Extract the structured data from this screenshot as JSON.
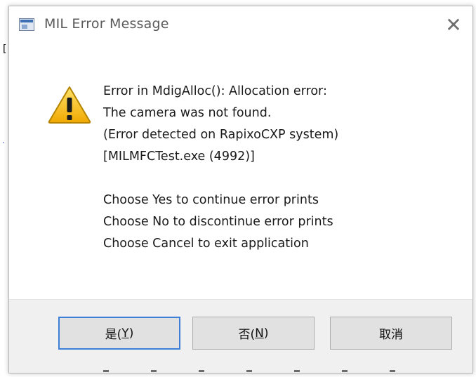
{
  "window": {
    "title": "MIL Error Message",
    "close_glyph": "✕"
  },
  "icons": {
    "app": "app-window-icon",
    "warning": "warning-icon",
    "close": "close-icon"
  },
  "background": {
    "glyph_a": "[",
    "glyph_b": "."
  },
  "message": {
    "lines": [
      "Error in MdigAlloc(): Allocation error:",
      "The camera was not found.",
      "(Error detected on RapixoCXP system)",
      "[MILMFCTest.exe (4992)]",
      "",
      "Choose Yes to continue error prints",
      "Choose No to discontinue error prints",
      "Choose Cancel to exit application"
    ]
  },
  "buttons": {
    "yes": {
      "text": "是(",
      "key": "Y",
      "end": ")"
    },
    "no": {
      "text": "否(",
      "key": "N",
      "end": ")"
    },
    "cancel": {
      "label": "取消"
    }
  },
  "colors": {
    "focus_border": "#3c7fd6",
    "button_face": "#e1e1e1",
    "footer": "#f0f0f0",
    "warning_yellow": "#f6c21c"
  }
}
